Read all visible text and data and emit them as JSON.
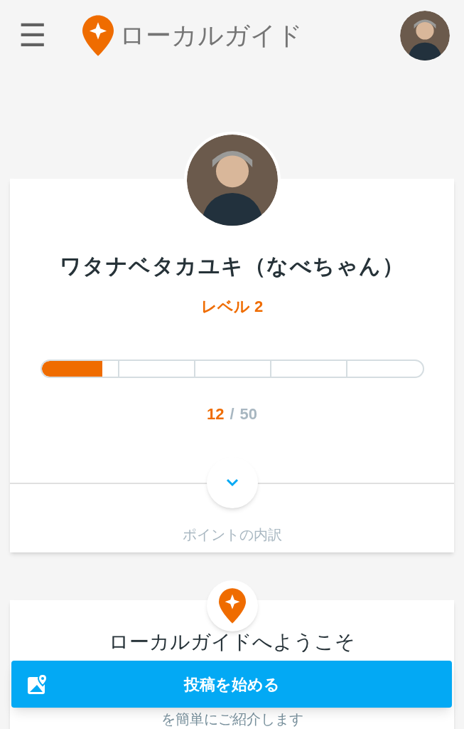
{
  "header": {
    "menu_icon": "☰",
    "title": "ローカルガイド"
  },
  "profile": {
    "name": "ワタナベタカユキ（なべちゃん）",
    "level_label": "レベル 2",
    "progress": {
      "level": 0.16
    },
    "points": "12",
    "separator": "/",
    "points_goal": "50",
    "breakdown_label": "ポイントの内訳",
    "expanded": false
  },
  "welcome": {
    "title": "ローカルガイドへようこそ",
    "subtitle": "を簡単にご紹介します"
  },
  "action_button": {
    "label": "投稿を始める"
  }
}
